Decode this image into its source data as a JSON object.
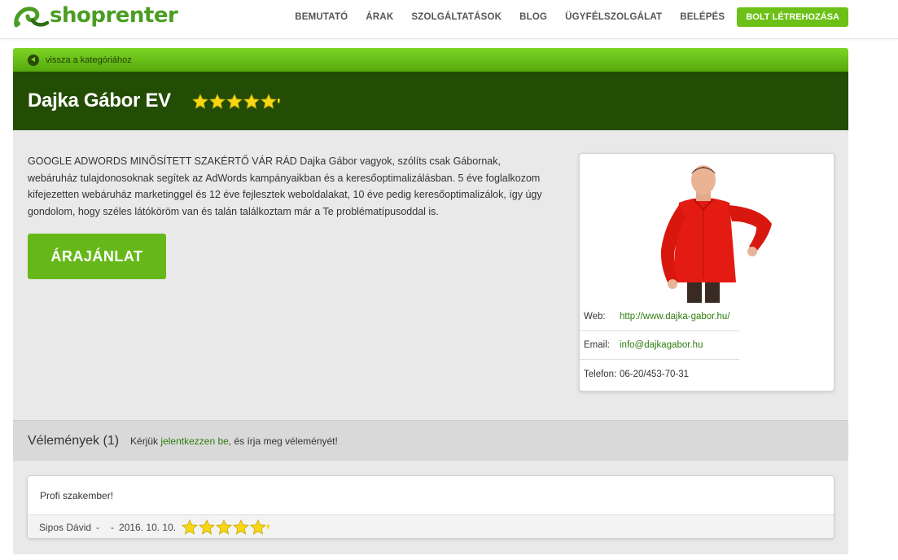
{
  "header": {
    "logo_text": "shoprenter",
    "nav": [
      {
        "label": "BEMUTATÓ"
      },
      {
        "label": "ÁRAK"
      },
      {
        "label": "SZOLGÁLTATÁSOK"
      },
      {
        "label": "BLOG"
      },
      {
        "label": "ÜGYFÉLSZOLGÁLAT"
      },
      {
        "label": "BELÉPÉS"
      }
    ],
    "cta_label": "BOLT LÉTREHOZÁSA"
  },
  "back": {
    "label": "vissza a kategóriához"
  },
  "profile": {
    "name": "Dajka Gábor EV",
    "rating_stars": 5,
    "description": "GOOGLE ADWORDS MINŐSÍTETT SZAKÉRTŐ VÁR RÁD Dajka Gábor vagyok, szólíts csak Gábornak, webáruház tulajdonosoknak segítek az AdWords kampányaikban és a keresőoptimalizálásban. 5 éve foglalkozom kifejezetten webáruház marketinggel és 12 éve fejlesztek weboldalakat, 10 éve pedig keresőoptimalizálok, így úgy gondolom, hogy széles látóköröm van és talán találkoztam már a Te problématípusoddal is.",
    "offer_button": "ÁRAJÁNLAT",
    "contact": {
      "web_label": "Web:",
      "web_value": "http://www.dajka-gabor.hu/",
      "email_label": "Email:",
      "email_value": "info@dajkagabor.hu",
      "phone_label": "Telefon:",
      "phone_value": "06-20/453-70-31"
    }
  },
  "reviews": {
    "title": "Vélemények (1)",
    "note_before": "Kérjük ",
    "note_link": "jelentkezzen be",
    "note_after": ", és írja meg véleményét!",
    "items": [
      {
        "text": "Profi szakember!",
        "author": "Sipos Dávid",
        "sep1": "-",
        "sep2": "-",
        "date": "2016. 10. 10.",
        "stars": 5
      }
    ]
  },
  "colors": {
    "brand_green": "#6cc017",
    "dark_green": "#234d04",
    "link_green": "#2f7d0e",
    "star_yellow": "#f7d716"
  }
}
